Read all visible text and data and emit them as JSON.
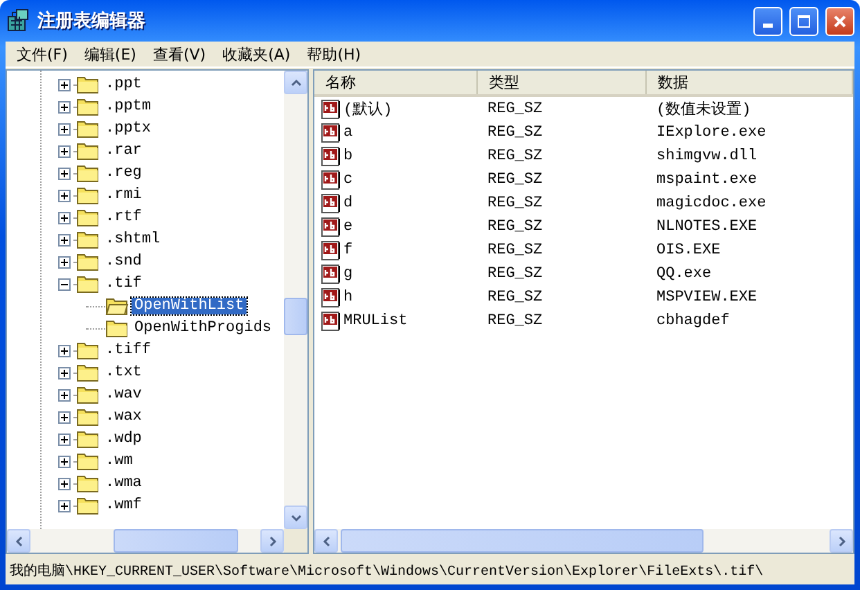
{
  "window": {
    "title": "注册表编辑器"
  },
  "menu": [
    "文件(F)",
    "编辑(E)",
    "查看(V)",
    "收藏夹(A)",
    "帮助(H)"
  ],
  "tree": {
    "items": [
      {
        "label": ".ppt",
        "expanded": false,
        "selected": false
      },
      {
        "label": ".pptm",
        "expanded": false,
        "selected": false
      },
      {
        "label": ".pptx",
        "expanded": false,
        "selected": false
      },
      {
        "label": ".rar",
        "expanded": false,
        "selected": false
      },
      {
        "label": ".reg",
        "expanded": false,
        "selected": false
      },
      {
        "label": ".rmi",
        "expanded": false,
        "selected": false
      },
      {
        "label": ".rtf",
        "expanded": false,
        "selected": false
      },
      {
        "label": ".shtml",
        "expanded": false,
        "selected": false
      },
      {
        "label": ".snd",
        "expanded": false,
        "selected": false
      },
      {
        "label": ".tif",
        "expanded": true,
        "selected": false,
        "children": [
          {
            "label": "OpenWithList",
            "selected": true
          },
          {
            "label": "OpenWithProgids",
            "selected": false
          }
        ]
      },
      {
        "label": ".tiff",
        "expanded": false,
        "selected": false
      },
      {
        "label": ".txt",
        "expanded": false,
        "selected": false
      },
      {
        "label": ".wav",
        "expanded": false,
        "selected": false
      },
      {
        "label": ".wax",
        "expanded": false,
        "selected": false
      },
      {
        "label": ".wdp",
        "expanded": false,
        "selected": false
      },
      {
        "label": ".wm",
        "expanded": false,
        "selected": false
      },
      {
        "label": ".wma",
        "expanded": false,
        "selected": false
      },
      {
        "label": ".wmf",
        "expanded": false,
        "selected": false
      }
    ]
  },
  "table": {
    "columns": [
      "名称",
      "类型",
      "数据"
    ],
    "rows": [
      {
        "name": "(默认)",
        "type": "REG_SZ",
        "data": "(数值未设置)"
      },
      {
        "name": "a",
        "type": "REG_SZ",
        "data": "IExplore.exe"
      },
      {
        "name": "b",
        "type": "REG_SZ",
        "data": "shimgvw.dll"
      },
      {
        "name": "c",
        "type": "REG_SZ",
        "data": "mspaint.exe"
      },
      {
        "name": "d",
        "type": "REG_SZ",
        "data": "magicdoc.exe"
      },
      {
        "name": "e",
        "type": "REG_SZ",
        "data": "NLNOTES.EXE"
      },
      {
        "name": "f",
        "type": "REG_SZ",
        "data": "OIS.EXE"
      },
      {
        "name": "g",
        "type": "REG_SZ",
        "data": "QQ.exe"
      },
      {
        "name": "h",
        "type": "REG_SZ",
        "data": "MSPVIEW.EXE"
      },
      {
        "name": "MRUList",
        "type": "REG_SZ",
        "data": "cbhagdef"
      }
    ]
  },
  "status_bar": "我的电脑\\HKEY_CURRENT_USER\\Software\\Microsoft\\Windows\\CurrentVersion\\Explorer\\FileExts\\.tif\\"
}
